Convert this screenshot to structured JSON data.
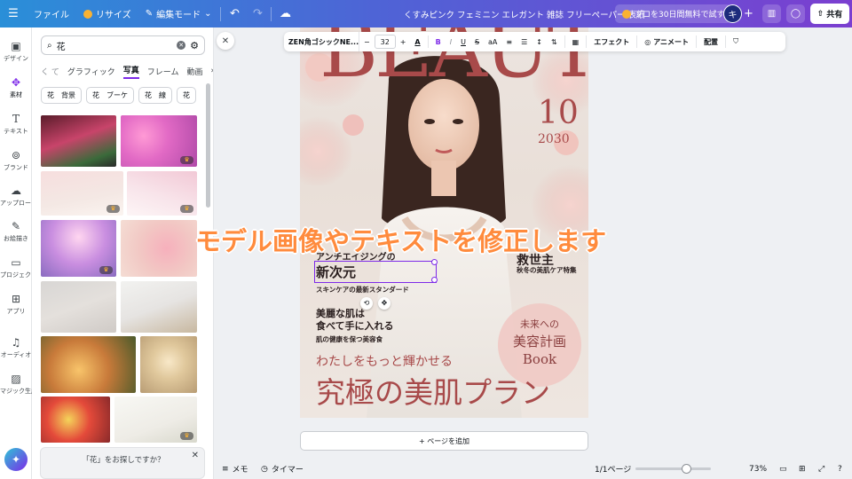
{
  "topbar": {
    "menu_icon": "menu-icon",
    "file_label": "ファイル",
    "resize_label": "リサイズ",
    "edit_mode_label": "編集モード",
    "doc_title": "くすみピンク フェミニン エレガント 雑誌 フリーペーパー 表紙",
    "pro_label": "プロを30日間無料で試す",
    "avatar_initial": "キ",
    "share_label": "共有"
  },
  "rail": [
    {
      "icon": "design-icon",
      "label": "デザイン"
    },
    {
      "icon": "elements-icon",
      "label": "素材"
    },
    {
      "icon": "text-icon",
      "label": "テキスト"
    },
    {
      "icon": "brand-icon",
      "label": "ブランド"
    },
    {
      "icon": "upload-icon",
      "label": "アップロード"
    },
    {
      "icon": "draw-icon",
      "label": "お絵描き"
    },
    {
      "icon": "project-icon",
      "label": "プロジェクト"
    },
    {
      "icon": "apps-icon",
      "label": "アプリ"
    },
    {
      "icon": "audio-icon",
      "label": "オーディオ"
    },
    {
      "icon": "magic-icon",
      "label": "マジック生成"
    }
  ],
  "panel": {
    "search_value": "花",
    "tabs": [
      "グラフィック",
      "写真",
      "フレーム",
      "動画"
    ],
    "active_tab": "写真",
    "chips": [
      "花　背景",
      "花　ブーケ",
      "花　線",
      "花"
    ],
    "suggest_text": "「花」をお探しですか？"
  },
  "toolbar": {
    "font_name": "ZEN角ゴシックNE...",
    "font_size": "32",
    "effect_label": "エフェクト",
    "animate_label": "アニメート",
    "position_label": "配置"
  },
  "magazine": {
    "masthead": "BEAUTY",
    "issue_number": "10",
    "issue_year": "2030",
    "headline_line1": "アンチエイジングの",
    "headline_line2": "新次元",
    "headline_sub": "スキンケアの最新スタンダード",
    "right_head": "救世主",
    "right_sub": "秋冬の美肌ケア特集",
    "mid_line1": "美麗な肌は",
    "mid_line2": "食べて手に入れる",
    "mid_sub": "肌の健康を保つ美容食",
    "circle_line1": "未来への",
    "circle_line2": "美容計画",
    "circle_line3": "Book",
    "tagline": "わたしをもっと輝かせる",
    "main_title": "究極の美肌プラン"
  },
  "overlay_caption": "モデル画像やテキストを修正します",
  "add_page_label": "+ ページを追加",
  "bottombar": {
    "notes_label": "メモ",
    "timer_label": "タイマー",
    "page_count": "1/1ページ",
    "zoom": "73%"
  },
  "colors": {
    "accent": "#7d2ae8",
    "caption": "#ff8b3d",
    "masthead": "#a84a4a"
  }
}
